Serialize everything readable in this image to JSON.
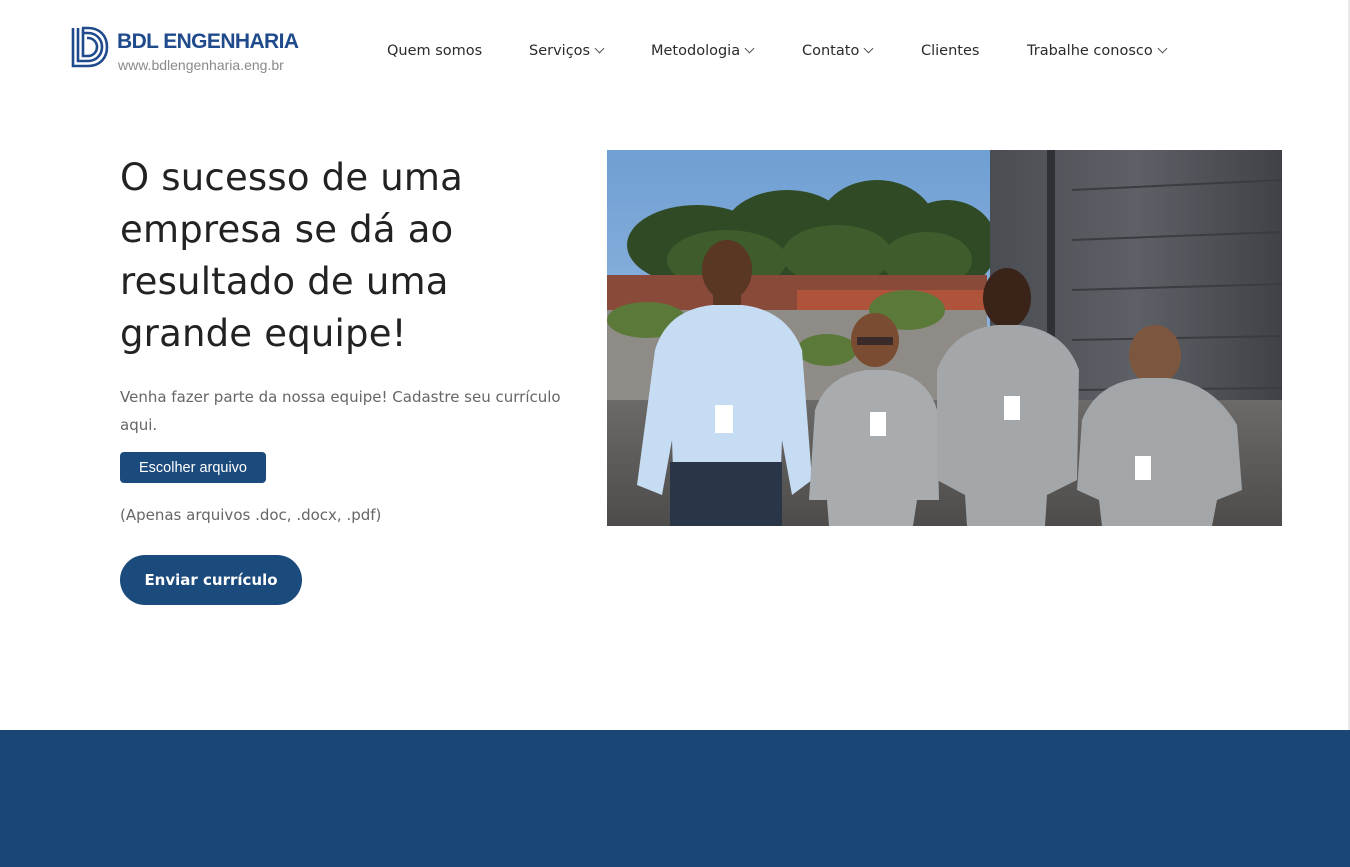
{
  "brand": {
    "name": "BDL ENGENHARIA",
    "url": "www.bdlengenharia.eng.br",
    "color": "#1f4a8c"
  },
  "nav": {
    "items": [
      {
        "label": "Quem somos",
        "dropdown": false
      },
      {
        "label": "Serviços",
        "dropdown": true
      },
      {
        "label": "Metodologia",
        "dropdown": true
      },
      {
        "label": "Contato",
        "dropdown": true
      },
      {
        "label": "Clientes",
        "dropdown": false
      },
      {
        "label": "Trabalhe conosco",
        "dropdown": true
      }
    ]
  },
  "hero": {
    "title": "O sucesso de uma empresa se dá ao resultado de uma grande equipe!",
    "text": "Venha fazer parte da nossa equipe! Cadastre seu currículo aqui.",
    "file_button": "Escolher arquivo",
    "file_note": "(Apenas arquivos .doc, .docx, .pdf)",
    "submit_button": "Enviar currículo"
  },
  "colors": {
    "primary": "#1b4a7c",
    "footer": "#1a4677"
  }
}
